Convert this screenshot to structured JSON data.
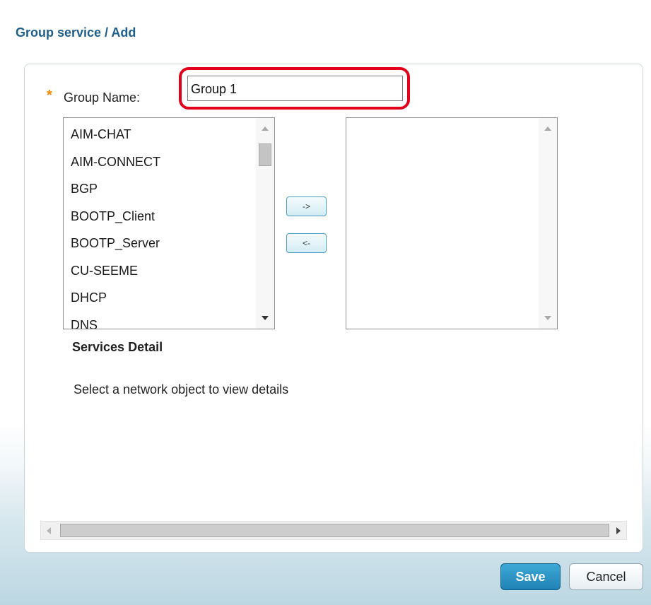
{
  "page": {
    "title": "Group service / Add"
  },
  "form": {
    "required_marker": "*",
    "group_name_label": "Group Name:",
    "group_name_value": "Group 1"
  },
  "available_services": [
    "AIM-CHAT",
    "AIM-CONNECT",
    "BGP",
    "BOOTP_Client",
    "BOOTP_Server",
    "CU-SEEME",
    "DHCP",
    "DNS"
  ],
  "selected_services": [],
  "transfer": {
    "add_label": "->",
    "remove_label": "<-"
  },
  "details": {
    "title": "Services Detail",
    "text": "Select a network object to view details"
  },
  "buttons": {
    "save": "Save",
    "cancel": "Cancel"
  },
  "colors": {
    "highlight": "#e3001b",
    "required": "#f08a00",
    "primary": "#1f82b6",
    "title": "#1f5f8b"
  }
}
